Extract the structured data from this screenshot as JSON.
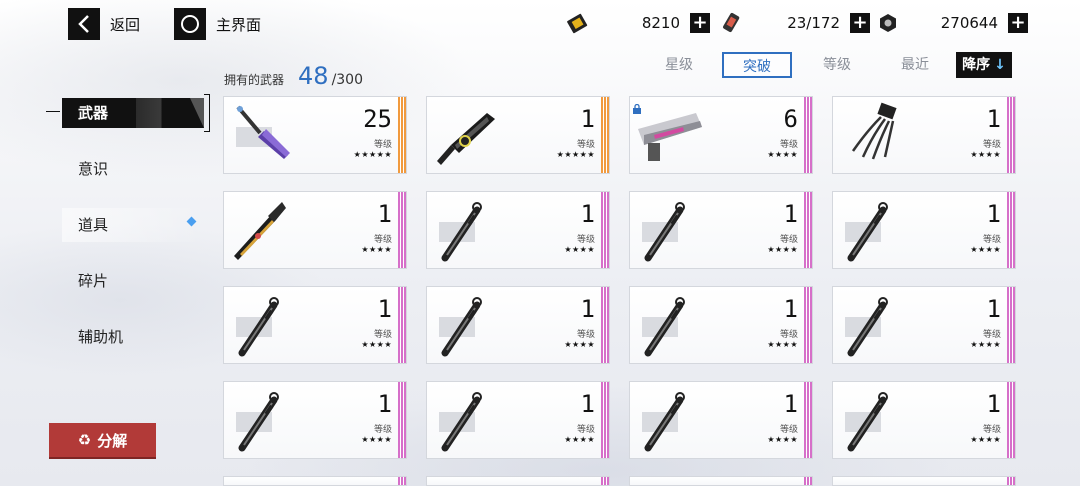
{
  "top": {
    "back_label": "返回",
    "home_label": "主界面",
    "resources": [
      {
        "icon": "ticket-icon",
        "value": "8210"
      },
      {
        "icon": "energy-canister-icon",
        "value": "23/172"
      },
      {
        "icon": "nut-coin-icon",
        "value": "270644"
      }
    ]
  },
  "owned": {
    "label": "拥有的武器",
    "count": "48",
    "total": "/300"
  },
  "sort": {
    "star": "星级",
    "breakthrough": "突破",
    "level": "等级",
    "recent": "最近",
    "desc": "降序",
    "desc_arrow": "↓",
    "active": "突破"
  },
  "nav": {
    "items": [
      {
        "label": "武器",
        "active": true
      },
      {
        "label": "意识"
      },
      {
        "label": "道具",
        "has_new": true
      },
      {
        "label": "碎片"
      },
      {
        "label": "辅助机"
      }
    ]
  },
  "decompose_label": "分解",
  "level_label": "等级",
  "colors": {
    "accent_blue": "#2f6fc0",
    "rarity_orange": "#f19a3e",
    "rarity_pink": "#d66fc9",
    "decompose_red": "#b23a38"
  },
  "weapons": [
    {
      "level": "25",
      "stars": "★★★★★",
      "rarity": "orange",
      "icon": "purple-blade-icon"
    },
    {
      "level": "1",
      "stars": "★★★★★",
      "rarity": "orange",
      "icon": "dark-chainsword-icon"
    },
    {
      "level": "6",
      "stars": "★★★★",
      "rarity": "pink",
      "icon": "cannon-icon",
      "locked": true
    },
    {
      "level": "1",
      "stars": "★★★★",
      "rarity": "pink",
      "icon": "claw-icon"
    },
    {
      "level": "1",
      "stars": "★★★★",
      "rarity": "pink",
      "icon": "gold-blade-icon"
    },
    {
      "level": "1",
      "stars": "★★★★",
      "rarity": "pink",
      "icon": "sword-icon"
    },
    {
      "level": "1",
      "stars": "★★★★",
      "rarity": "pink",
      "icon": "sword-icon"
    },
    {
      "level": "1",
      "stars": "★★★★",
      "rarity": "pink",
      "icon": "sword-icon"
    },
    {
      "level": "1",
      "stars": "★★★★",
      "rarity": "pink",
      "icon": "sword-icon"
    },
    {
      "level": "1",
      "stars": "★★★★",
      "rarity": "pink",
      "icon": "sword-icon"
    },
    {
      "level": "1",
      "stars": "★★★★",
      "rarity": "pink",
      "icon": "sword-icon"
    },
    {
      "level": "1",
      "stars": "★★★★",
      "rarity": "pink",
      "icon": "sword-icon"
    },
    {
      "level": "1",
      "stars": "★★★★",
      "rarity": "pink",
      "icon": "sword-icon"
    },
    {
      "level": "1",
      "stars": "★★★★",
      "rarity": "pink",
      "icon": "sword-icon"
    },
    {
      "level": "1",
      "stars": "★★★★",
      "rarity": "pink",
      "icon": "sword-icon"
    },
    {
      "level": "1",
      "stars": "★★★★",
      "rarity": "pink",
      "icon": "sword-icon"
    }
  ]
}
